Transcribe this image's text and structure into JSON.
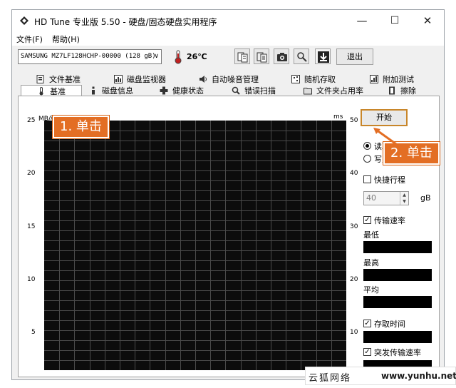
{
  "window": {
    "title": "HD Tune 专业版 5.50 - 硬盘/固态硬盘实用程序",
    "min_glyph": "—",
    "max_glyph": "☐",
    "close_glyph": "✕",
    "icon": "diamond-app-icon"
  },
  "menu": {
    "file": "文件(F)",
    "help": "帮助(H)"
  },
  "toolbar": {
    "drive": "SAMSUNG MZ7LF128HCHP-00000 (128 gB)",
    "drive_dropdown_glyph": "∨",
    "temperature": "26℃",
    "exit_label": "退出",
    "icons": [
      "copy-info-icon",
      "copy-all-icon",
      "screenshot-icon",
      "options-icon",
      "save-download-icon"
    ]
  },
  "tabs_row1": [
    {
      "label": "文件基准",
      "icon": "file-benchmark-icon"
    },
    {
      "label": "磁盘监视器",
      "icon": "disk-monitor-icon"
    },
    {
      "label": "自动噪音管理",
      "icon": "speaker-icon"
    },
    {
      "label": "随机存取",
      "icon": "random-access-icon"
    },
    {
      "label": "附加测试",
      "icon": "extra-tests-icon"
    }
  ],
  "tabs_row2": [
    {
      "label": "基准",
      "icon": "benchmark-icon",
      "active": true
    },
    {
      "label": "磁盘信息",
      "icon": "disk-info-icon"
    },
    {
      "label": "健康状态",
      "icon": "health-icon"
    },
    {
      "label": "错误扫描",
      "icon": "error-scan-icon"
    },
    {
      "label": "文件夹占用率",
      "icon": "folder-usage-icon"
    },
    {
      "label": "擦除",
      "icon": "erase-icon"
    }
  ],
  "chart": {
    "y_left_unit": "MB/秒",
    "y_right_unit": "ms",
    "y_left_ticks": [
      "25",
      "20",
      "15",
      "10",
      "5"
    ],
    "y_right_ticks": [
      "50",
      "40",
      "30",
      "20",
      "10"
    ]
  },
  "chart_data": {
    "type": "line",
    "series": [],
    "ylim_left": [
      0,
      25
    ],
    "ylim_right": [
      0,
      50
    ],
    "grid": true,
    "background": "#0c0c0c",
    "grid_color": "#4a4a4a"
  },
  "controls": {
    "start_label": "开始",
    "read_label": "读取",
    "read_checked": true,
    "write_label": "写入",
    "write_checked": false,
    "short_stroke_label": "快捷行程",
    "short_stroke_checked": false,
    "short_stroke_value": "40",
    "short_stroke_unit": "gB",
    "transfer_rate_label": "传输速率",
    "transfer_rate_checked": true,
    "min_label": "最低",
    "max_label": "最高",
    "avg_label": "平均",
    "access_time_label": "存取时间",
    "access_time_checked": true,
    "burst_rate_label": "突发传输速率",
    "burst_rate_checked": true
  },
  "annotations": {
    "step1": "1. 单击",
    "step2": "2. 单击"
  },
  "watermark": {
    "site_cn": "云狐网络",
    "url": "www.yunhu.net"
  },
  "colors": {
    "annotation": "#e36e24",
    "start_highlight": "#c8862a"
  }
}
